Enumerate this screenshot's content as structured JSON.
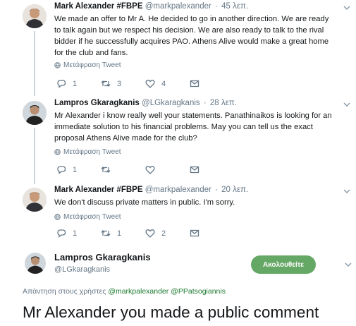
{
  "tweets": [
    {
      "name": "Mark Alexander #FBPE",
      "handle": "@markpalexander",
      "time": "45 λεπ.",
      "text": "We made an offer to Mr A. He decided to go in another direction. We are ready to talk again but we respect his decision. We are also ready to talk to the rival bidder if he successfully acquires PAO. Athens Alive would make a great home for the club and fans.",
      "translate": "Μετάφραση Tweet",
      "reply_count": "1",
      "retweet_count": "3",
      "like_count": "4"
    },
    {
      "name": "Lampros Gkaragkanis",
      "handle": "@LGkaragkanis",
      "time": "28 λεπ.",
      "text": "Mr Alexander i know really well your statements. Panathinaikos is looking for an immediate solution to his financial problems. May you can tell us the exact proposal Athens Alive made for the club?",
      "translate": "Μετάφραση Tweet",
      "reply_count": "1",
      "retweet_count": "",
      "like_count": ""
    },
    {
      "name": "Mark Alexander #FBPE",
      "handle": "@markpalexander",
      "time": "20 λεπ.",
      "text": "We don't discuss private matters in public. I'm sorry.",
      "translate": "Μετάφραση Tweet",
      "reply_count": "1",
      "retweet_count": "1",
      "like_count": "2"
    }
  ],
  "separator": "·",
  "main": {
    "name": "Lampros Gkaragkanis",
    "handle": "@LGkaragkanis",
    "follow_label": "Ακολουθείτε",
    "reply_prefix": "Απάντηση στους χρήστες",
    "mention_1": "@markpalexander",
    "mention_2": "@PPatsogiannis",
    "text": "Mr Alexander you made a public comment"
  },
  "colors": {
    "follow": "#65a765",
    "mention": "#1b7a2e",
    "secondary": "#657786",
    "thread_line": "#ccd6dd"
  },
  "icons": [
    "globe-icon",
    "reply-icon",
    "retweet-icon",
    "like-icon",
    "mail-icon",
    "chevron-down-icon"
  ]
}
